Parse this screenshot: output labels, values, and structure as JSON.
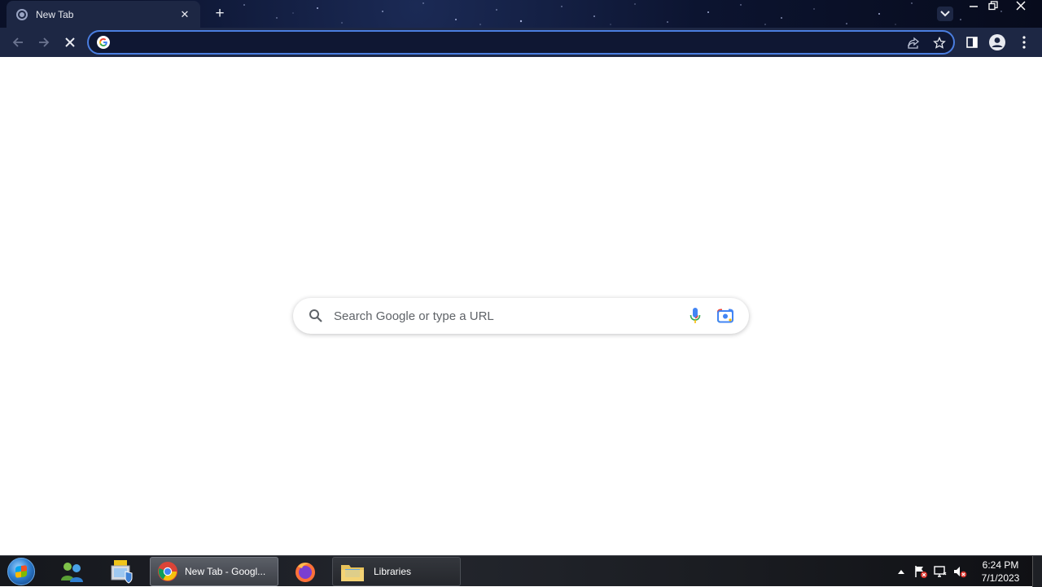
{
  "browser": {
    "tab": {
      "title": "New Tab"
    },
    "omnibox": {
      "value": "",
      "placeholder": ""
    }
  },
  "ntp": {
    "search_placeholder": "Search Google or type a URL"
  },
  "taskbar": {
    "items": [
      {
        "label": "New Tab - Googl...",
        "app": "chrome",
        "active": true
      },
      {
        "label": "Libraries",
        "app": "windows-explorer",
        "active": false
      }
    ],
    "clock": {
      "time": "6:24 PM",
      "date": "7/1/2023"
    }
  },
  "colors": {
    "chrome_frame": "#1d2744",
    "omnibox_focus": "#4a7ee0",
    "google_blue": "#4285f4",
    "google_red": "#ea4335",
    "google_yellow": "#fbbc05",
    "google_green": "#34a853"
  }
}
